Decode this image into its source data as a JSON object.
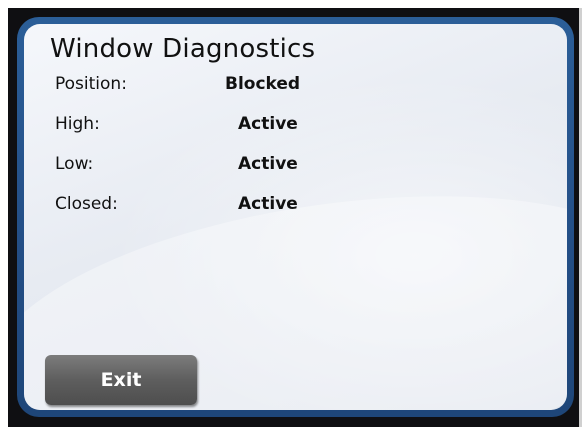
{
  "title": "Window Diagnostics",
  "diagnostics": [
    {
      "label": "Position:",
      "value": "Blocked"
    },
    {
      "label": "High:",
      "value": "Active"
    },
    {
      "label": "Low:",
      "value": "Active"
    },
    {
      "label": "Closed:",
      "value": "Active"
    }
  ],
  "exit_label": "Exit"
}
